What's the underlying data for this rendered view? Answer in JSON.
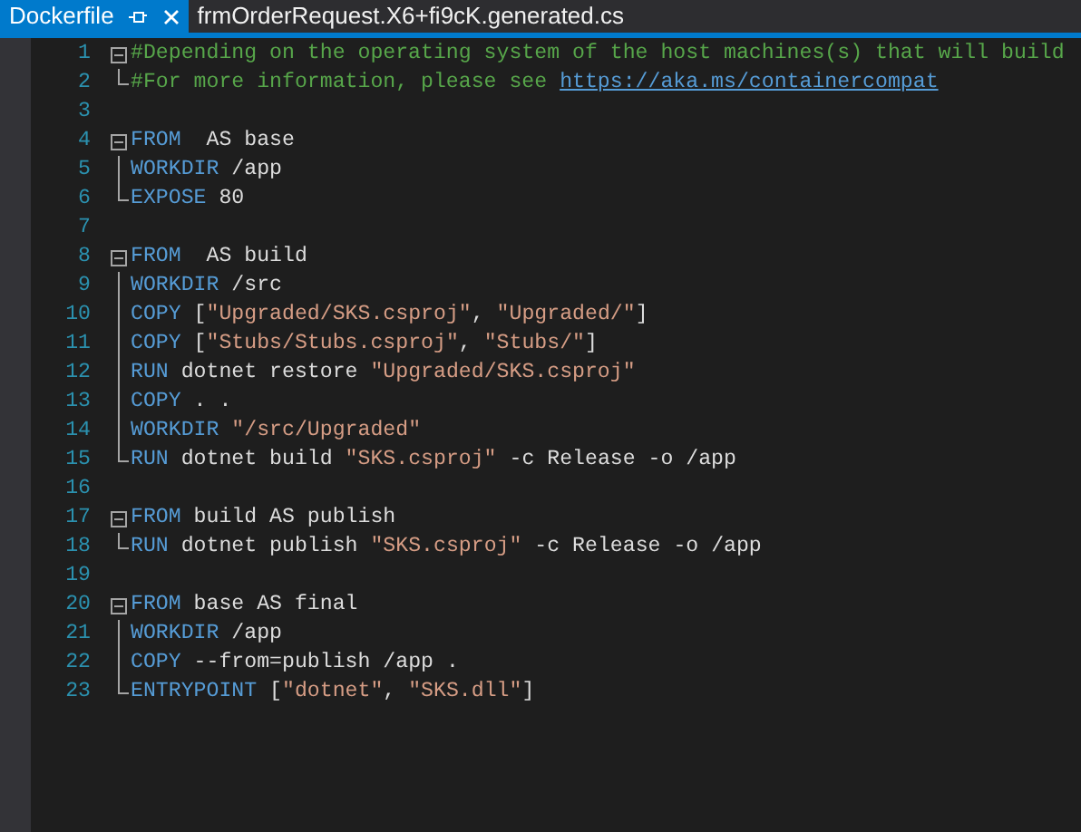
{
  "tabs": [
    {
      "label": "Dockerfile",
      "selected": true,
      "pinnable": true,
      "closable": true
    },
    {
      "label": "frmOrderRequest.X6+fi9cK.generated.cs",
      "selected": false,
      "pinnable": false,
      "closable": false
    }
  ],
  "editor": {
    "lines": [
      {
        "number": "1",
        "kind": "start",
        "tokens": [
          {
            "kind": "comment",
            "text": "#Depending on the operating system of the host machines(s) that will build"
          }
        ]
      },
      {
        "number": "2",
        "kind": "end",
        "tokens": [
          {
            "kind": "comment",
            "text": "#For more information, please see "
          },
          {
            "kind": "link",
            "text": "https://aka.ms/containercompat"
          }
        ]
      },
      {
        "number": "3",
        "kind": "blank"
      },
      {
        "number": "4",
        "kind": "start",
        "tokens": [
          {
            "kind": "keyword",
            "text": "FROM"
          },
          {
            "kind": "plain",
            "text": "  AS base"
          }
        ]
      },
      {
        "number": "5",
        "kind": "mid",
        "tokens": [
          {
            "kind": "keyword",
            "text": "WORKDIR"
          },
          {
            "kind": "plain",
            "text": " /app"
          }
        ]
      },
      {
        "number": "6",
        "kind": "end",
        "tokens": [
          {
            "kind": "keyword",
            "text": "EXPOSE"
          },
          {
            "kind": "plain",
            "text": " 80"
          }
        ]
      },
      {
        "number": "7",
        "kind": "blank"
      },
      {
        "number": "8",
        "kind": "start",
        "tokens": [
          {
            "kind": "keyword",
            "text": "FROM"
          },
          {
            "kind": "plain",
            "text": "  AS build"
          }
        ]
      },
      {
        "number": "9",
        "kind": "mid",
        "tokens": [
          {
            "kind": "keyword",
            "text": "WORKDIR"
          },
          {
            "kind": "plain",
            "text": " /src"
          }
        ]
      },
      {
        "number": "10",
        "kind": "mid",
        "tokens": [
          {
            "kind": "keyword",
            "text": "COPY"
          },
          {
            "kind": "plain",
            "text": " ["
          },
          {
            "kind": "string",
            "text": "\"Upgraded/SKS.csproj\""
          },
          {
            "kind": "plain",
            "text": ", "
          },
          {
            "kind": "string",
            "text": "\"Upgraded/\""
          },
          {
            "kind": "plain",
            "text": "]"
          }
        ]
      },
      {
        "number": "11",
        "kind": "mid",
        "tokens": [
          {
            "kind": "keyword",
            "text": "COPY"
          },
          {
            "kind": "plain",
            "text": " ["
          },
          {
            "kind": "string",
            "text": "\"Stubs/Stubs.csproj\""
          },
          {
            "kind": "plain",
            "text": ", "
          },
          {
            "kind": "string",
            "text": "\"Stubs/\""
          },
          {
            "kind": "plain",
            "text": "]"
          }
        ]
      },
      {
        "number": "12",
        "kind": "mid",
        "tokens": [
          {
            "kind": "keyword",
            "text": "RUN"
          },
          {
            "kind": "plain",
            "text": " dotnet restore "
          },
          {
            "kind": "string",
            "text": "\"Upgraded/SKS.csproj\""
          }
        ]
      },
      {
        "number": "13",
        "kind": "mid",
        "tokens": [
          {
            "kind": "keyword",
            "text": "COPY"
          },
          {
            "kind": "plain",
            "text": " . ."
          }
        ]
      },
      {
        "number": "14",
        "kind": "mid",
        "tokens": [
          {
            "kind": "keyword",
            "text": "WORKDIR"
          },
          {
            "kind": "string",
            "text": " \"/src/Upgraded\""
          }
        ]
      },
      {
        "number": "15",
        "kind": "end",
        "tokens": [
          {
            "kind": "keyword",
            "text": "RUN"
          },
          {
            "kind": "plain",
            "text": " dotnet build "
          },
          {
            "kind": "string",
            "text": "\"SKS.csproj\""
          },
          {
            "kind": "plain",
            "text": " -c Release -o /app"
          }
        ]
      },
      {
        "number": "16",
        "kind": "blank"
      },
      {
        "number": "17",
        "kind": "start",
        "tokens": [
          {
            "kind": "keyword",
            "text": "FROM"
          },
          {
            "kind": "plain",
            "text": " build AS publish"
          }
        ]
      },
      {
        "number": "18",
        "kind": "end",
        "tokens": [
          {
            "kind": "keyword",
            "text": "RUN"
          },
          {
            "kind": "plain",
            "text": " dotnet publish "
          },
          {
            "kind": "string",
            "text": "\"SKS.csproj\""
          },
          {
            "kind": "plain",
            "text": " -c Release -o /app"
          }
        ]
      },
      {
        "number": "19",
        "kind": "blank"
      },
      {
        "number": "20",
        "kind": "start",
        "tokens": [
          {
            "kind": "keyword",
            "text": "FROM"
          },
          {
            "kind": "plain",
            "text": " base AS final"
          }
        ]
      },
      {
        "number": "21",
        "kind": "mid",
        "tokens": [
          {
            "kind": "keyword",
            "text": "WORKDIR"
          },
          {
            "kind": "plain",
            "text": " /app"
          }
        ]
      },
      {
        "number": "22",
        "kind": "mid",
        "tokens": [
          {
            "kind": "keyword",
            "text": "COPY"
          },
          {
            "kind": "plain",
            "text": " --from=publish /app ."
          }
        ]
      },
      {
        "number": "23",
        "kind": "end",
        "tokens": [
          {
            "kind": "keyword",
            "text": "ENTRYPOINT"
          },
          {
            "kind": "plain",
            "text": " ["
          },
          {
            "kind": "string",
            "text": "\"dotnet\""
          },
          {
            "kind": "plain",
            "text": ", "
          },
          {
            "kind": "string",
            "text": "\"SKS.dll\""
          },
          {
            "kind": "plain",
            "text": "]"
          }
        ]
      }
    ]
  }
}
